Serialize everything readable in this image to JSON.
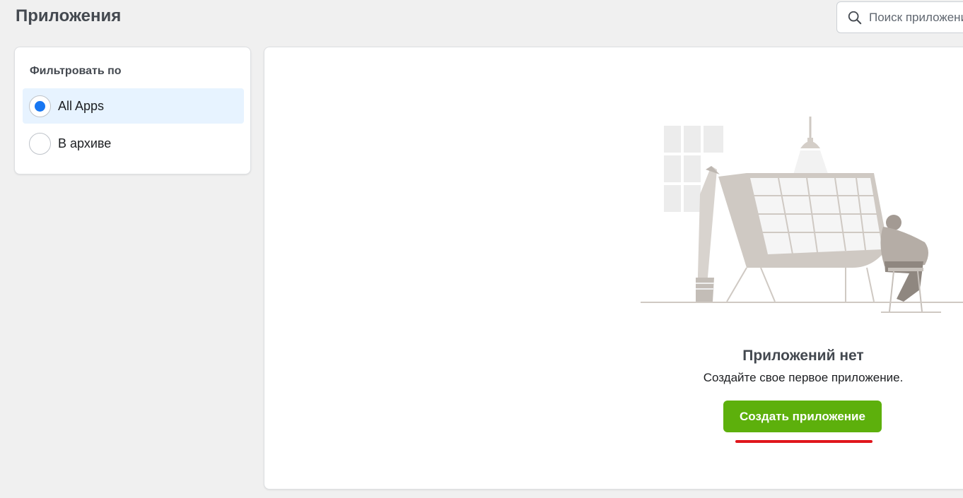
{
  "page": {
    "title": "Приложения"
  },
  "search": {
    "placeholder": "Поиск приложений",
    "icon": "search-icon"
  },
  "filter": {
    "title": "Фильтровать по",
    "options": [
      {
        "label": "All Apps",
        "selected": true
      },
      {
        "label": "В архиве",
        "selected": false
      }
    ]
  },
  "empty_state": {
    "title": "Приложений нет",
    "subtitle": "Создайте свое первое приложение.",
    "button_label": "Создать приложение",
    "illustration": "person-at-drafting-table-illustration"
  },
  "colors": {
    "accent": "#1877f2",
    "button": "#5db00c",
    "selected_bg": "#e7f3ff",
    "annotation_underline": "#e0161c"
  }
}
